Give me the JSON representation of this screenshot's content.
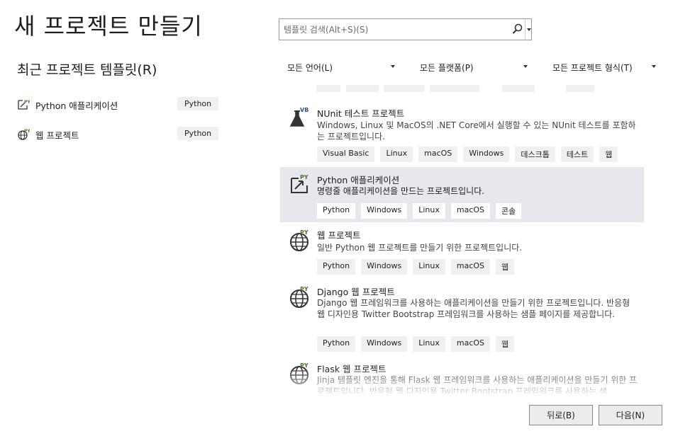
{
  "page_title": "새 프로젝트 만들기",
  "recent_section_title": "최근 프로젝트 템플릿(R)",
  "search": {
    "placeholder": "템플릿 검색(Alt+S)(S)",
    "icon": "search-icon"
  },
  "filters": {
    "language": "모든 언어(L)",
    "platform": "모든 플랫폼(P)",
    "project_type": "모든 프로젝트 형식(T)"
  },
  "recent": [
    {
      "label": "Python 애플리케이션",
      "tag": "Python",
      "icon": "python-app-icon"
    },
    {
      "label": "웹 프로젝트",
      "tag": "Python",
      "icon": "globe-icon"
    }
  ],
  "templates": [
    {
      "name": "NUnit 테스트 프로젝트",
      "description": "Windows, Linux 및 MacOS의 .NET Core에서 실행할 수 있는 NUnit 테스트를 포함하는 프로젝트입니다.",
      "tags": [
        "Visual Basic",
        "Linux",
        "macOS",
        "Windows",
        "데스크톱",
        "테스트",
        "웹"
      ],
      "icon": "vb-flask-icon",
      "icon_badge": "VB"
    },
    {
      "name": "Python 애플리케이션",
      "description": "명령줄 애플리케이션을 만드는 프로젝트입니다.",
      "tags": [
        "Python",
        "Windows",
        "Linux",
        "macOS",
        "콘솔"
      ],
      "icon": "python-app-icon",
      "icon_badge": "PY",
      "selected": true
    },
    {
      "name": "웹 프로젝트",
      "description": "일반 Python 웹 프로젝트를 만들기 위한 프로젝트입니다.",
      "tags": [
        "Python",
        "Windows",
        "Linux",
        "macOS",
        "웹"
      ],
      "icon": "globe-icon",
      "icon_badge": "PY"
    },
    {
      "name": "Django 웹 프로젝트",
      "description": "Django 웹 프레임워크를 사용하는 애플리케이션을 만들기 위한 프로젝트입니다. 반응형 웹 디자인용 Twitter Bootstrap 프레임워크를 사용하는 샘플 페이지를 제공합니다.",
      "tags": [
        "Python",
        "Windows",
        "Linux",
        "macOS",
        "웹"
      ],
      "icon": "globe-icon",
      "icon_badge": "PY"
    },
    {
      "name": "Flask 웹 프로젝트",
      "description": "Jinja 템플릿 엔진을 통해 Flask 웹 프레임워크를 사용하는 애플리케이션을 만들기 위한 프로젝트입니다. 반응형 웹 디자인용 Twitter Bootstrap 프레임워크를 사용하는 샘",
      "tags": [],
      "icon": "globe-icon",
      "icon_badge": "PY"
    }
  ],
  "buttons": {
    "back": "뒤로(B)",
    "next": "다음(N)"
  },
  "colors": {
    "selected_bg": "#e6e8ee",
    "tag_bg": "#f0f0f0",
    "py_badge": "#4a7a1e",
    "vb_badge": "#2b579a"
  }
}
